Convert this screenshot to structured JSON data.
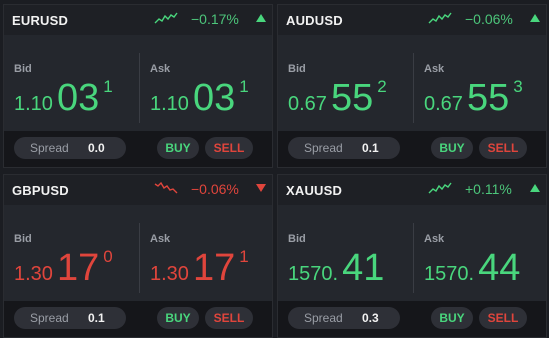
{
  "colors": {
    "up": "#49d67d",
    "down": "#e0453c",
    "background": "#1b1d22"
  },
  "cards": [
    {
      "symbol": "EURUSD",
      "change": "−0.17%",
      "trend": "up",
      "spark_icon": "sparkline-up-icon",
      "bid_label": "Bid",
      "ask_label": "Ask",
      "bid": {
        "small": "1.10",
        "big": "03",
        "sup": "1"
      },
      "ask": {
        "small": "1.10",
        "big": "03",
        "sup": "1"
      },
      "spread_label": "Spread",
      "spread": "0.0",
      "buy_label": "BUY",
      "sell_label": "SELL"
    },
    {
      "symbol": "AUDUSD",
      "change": "−0.06%",
      "trend": "up",
      "spark_icon": "sparkline-up-icon",
      "bid_label": "Bid",
      "ask_label": "Ask",
      "bid": {
        "small": "0.67",
        "big": "55",
        "sup": "2"
      },
      "ask": {
        "small": "0.67",
        "big": "55",
        "sup": "3"
      },
      "spread_label": "Spread",
      "spread": "0.1",
      "buy_label": "BUY",
      "sell_label": "SELL"
    },
    {
      "symbol": "GBPUSD",
      "change": "−0.06%",
      "trend": "down",
      "spark_icon": "sparkline-down-icon",
      "bid_label": "Bid",
      "ask_label": "Ask",
      "bid": {
        "small": "1.30",
        "big": "17",
        "sup": "0"
      },
      "ask": {
        "small": "1.30",
        "big": "17",
        "sup": "1"
      },
      "spread_label": "Spread",
      "spread": "0.1",
      "buy_label": "BUY",
      "sell_label": "SELL"
    },
    {
      "symbol": "XAUUSD",
      "change": "+0.11%",
      "trend": "up",
      "spark_icon": "sparkline-up-icon",
      "bid_label": "Bid",
      "ask_label": "Ask",
      "bid": {
        "small": "1570.",
        "big": "41",
        "sup": ""
      },
      "ask": {
        "small": "1570.",
        "big": "44",
        "sup": ""
      },
      "spread_label": "Spread",
      "spread": "0.3",
      "buy_label": "BUY",
      "sell_label": "SELL"
    }
  ]
}
